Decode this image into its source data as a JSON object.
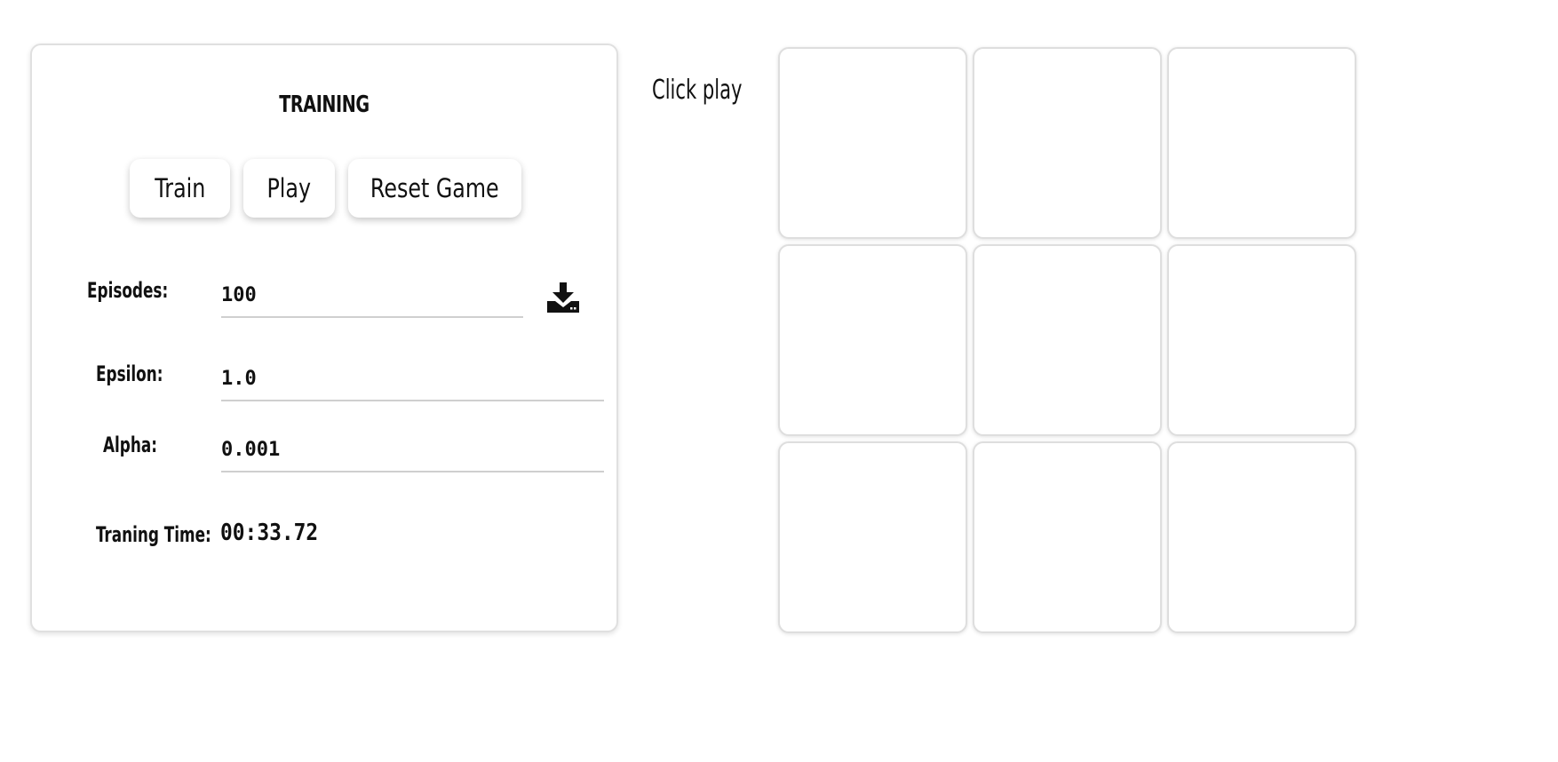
{
  "training": {
    "title": "TRAINING",
    "buttons": {
      "train": "Train",
      "play": "Play",
      "reset": "Reset Game"
    },
    "episodes": {
      "label": "Episodes:",
      "value": "100"
    },
    "epsilon": {
      "label": "Epsilon:",
      "value": "1.0"
    },
    "alpha": {
      "label": "Alpha:",
      "value": "0.001"
    },
    "time": {
      "label": "Traning Time:",
      "value": "00:33.72"
    },
    "download_icon": "download-icon"
  },
  "game": {
    "status": "Click play",
    "board": [
      "",
      "",
      "",
      "",
      "",
      "",
      "",
      "",
      ""
    ]
  }
}
